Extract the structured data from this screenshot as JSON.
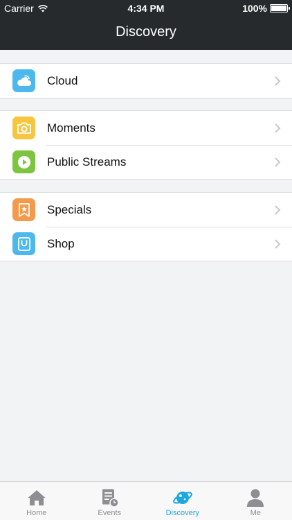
{
  "status_bar": {
    "carrier": "Carrier",
    "time": "4:34 PM",
    "battery": "100%"
  },
  "nav": {
    "title": "Discovery"
  },
  "groups": [
    {
      "items": [
        {
          "label": "Cloud",
          "icon": "cloud-icon",
          "color": "#4cb8ee"
        }
      ]
    },
    {
      "items": [
        {
          "label": "Moments",
          "icon": "camera-icon",
          "color": "#f7c53e"
        },
        {
          "label": "Public Streams",
          "icon": "play-icon",
          "color": "#7dc540"
        }
      ]
    },
    {
      "items": [
        {
          "label": "Specials",
          "icon": "star-bookmark-icon",
          "color": "#f59a4c"
        },
        {
          "label": "Shop",
          "icon": "shopping-bag-icon",
          "color": "#4cb8ee"
        }
      ]
    }
  ],
  "tabs": [
    {
      "label": "Home",
      "icon": "home-icon",
      "active": false
    },
    {
      "label": "Events",
      "icon": "events-icon",
      "active": false
    },
    {
      "label": "Discovery",
      "icon": "planet-icon",
      "active": true
    },
    {
      "label": "Me",
      "icon": "person-icon",
      "active": false
    }
  ],
  "colors": {
    "header": "#262a2c",
    "accent": "#1aa7e3",
    "background": "#f2f3f5"
  }
}
